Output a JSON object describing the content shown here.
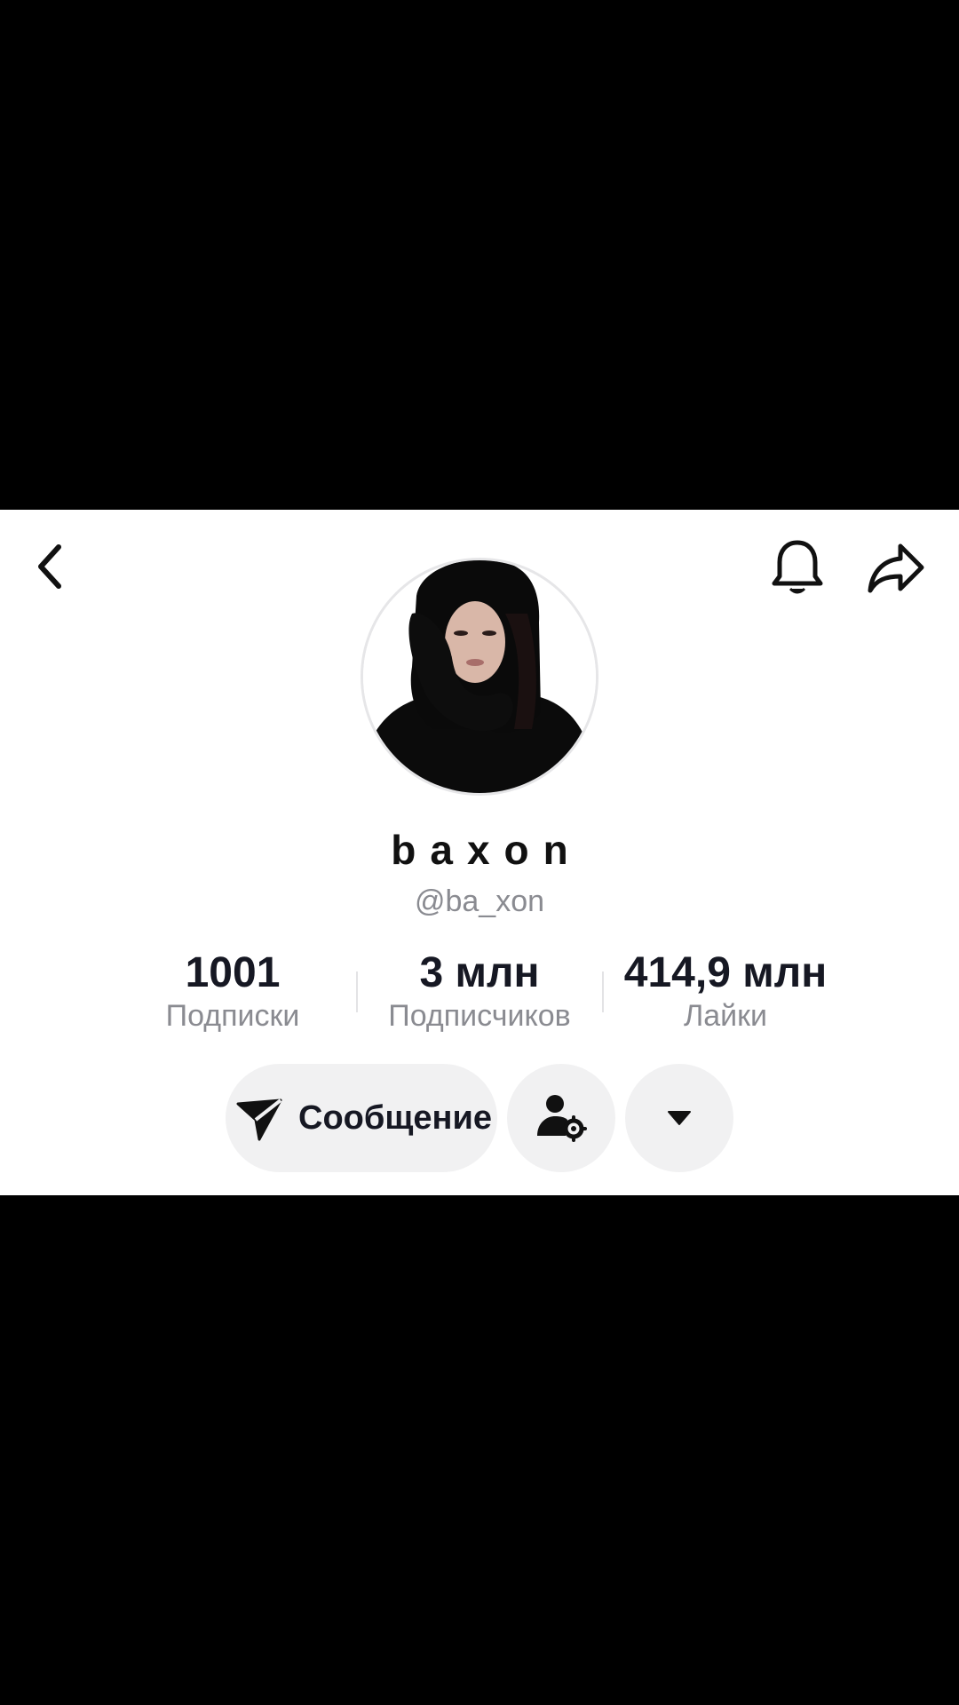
{
  "header": {
    "back_icon": "chevron-left-icon",
    "bell_icon": "bell-icon",
    "share_icon": "share-arrow-icon"
  },
  "profile": {
    "display_name": "baxon",
    "handle": "@ba_xon",
    "avatar": "profile-photo"
  },
  "stats": [
    {
      "value": "1001",
      "label": "Подписки"
    },
    {
      "value": "3 млн",
      "label": "Подписчиков"
    },
    {
      "value": "414,9 млн",
      "label": "Лайки"
    }
  ],
  "actions": {
    "message_label": "Сообщение",
    "message_icon": "send-icon",
    "friend_settings_icon": "user-settings-icon",
    "more_icon": "caret-down-icon"
  },
  "colors": {
    "background": "#000000",
    "panel": "#ffffff",
    "button_bg": "#f1f1f2",
    "secondary_text": "#8a8b91",
    "primary_text": "#161823"
  }
}
